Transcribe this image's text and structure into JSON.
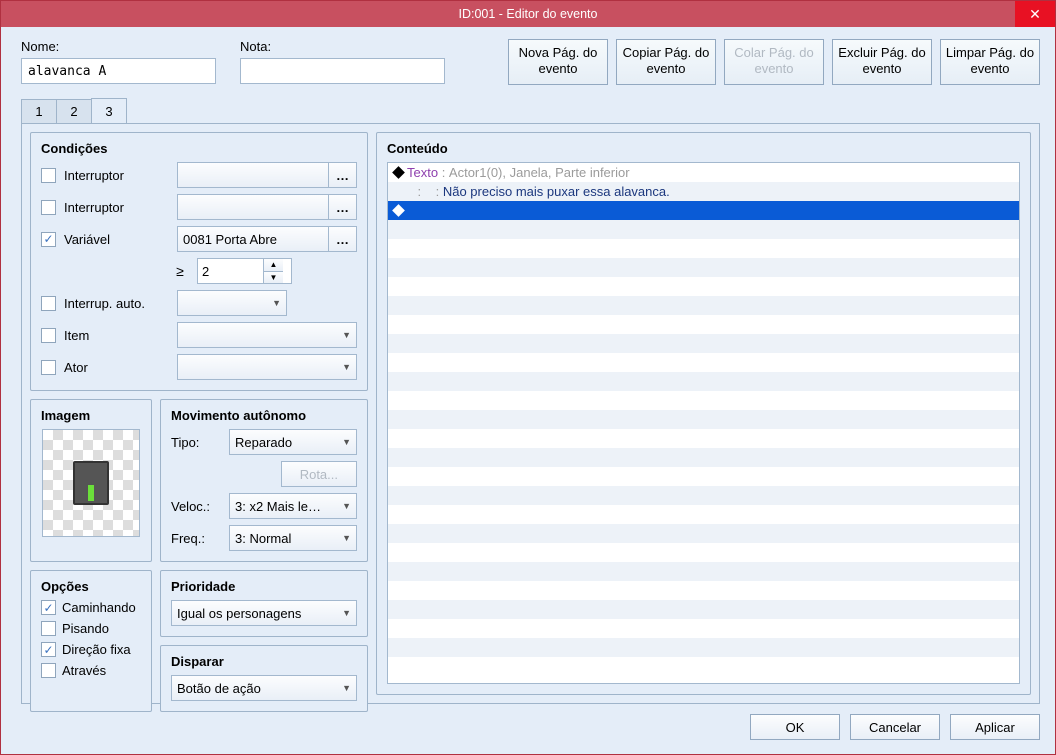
{
  "window": {
    "title": "ID:001 - Editor do evento"
  },
  "icons": {
    "close": "✕",
    "caret": "▼",
    "up": "▲",
    "down": "▼",
    "check": "✓"
  },
  "top": {
    "name_label": "Nome:",
    "name_value": "alavanca A",
    "note_label": "Nota:",
    "note_value": ""
  },
  "page_buttons": {
    "new": "Nova Pág. do evento",
    "copy": "Copiar Pág. do evento",
    "paste": "Colar Pág. do evento",
    "delete": "Excluir Pág. do evento",
    "clear": "Limpar Pág. do evento"
  },
  "tabs": [
    "1",
    "2",
    "3"
  ],
  "active_tab": 2,
  "conditions": {
    "title": "Condições",
    "switch1": {
      "checked": false,
      "label": "Interruptor",
      "value": ""
    },
    "switch2": {
      "checked": false,
      "label": "Interruptor",
      "value": ""
    },
    "variable": {
      "checked": true,
      "label": "Variável",
      "value": "0081 Porta Abre",
      "op": "≥",
      "num": "2"
    },
    "selfswitch": {
      "checked": false,
      "label": "Interrup. auto.",
      "value": ""
    },
    "item": {
      "checked": false,
      "label": "Item",
      "value": ""
    },
    "actor": {
      "checked": false,
      "label": "Ator",
      "value": ""
    }
  },
  "image": {
    "title": "Imagem"
  },
  "movement": {
    "title": "Movimento autônomo",
    "type_label": "Tipo:",
    "type_value": "Reparado",
    "route_btn": "Rota...",
    "speed_label": "Veloc.:",
    "speed_value": "3: x2 Mais le…",
    "freq_label": "Freq.:",
    "freq_value": "3: Normal"
  },
  "options": {
    "title": "Opções",
    "walk": {
      "checked": true,
      "label": "Caminhando"
    },
    "step": {
      "checked": false,
      "label": "Pisando"
    },
    "dirfix": {
      "checked": true,
      "label": "Direção fixa"
    },
    "through": {
      "checked": false,
      "label": "Através"
    }
  },
  "priority": {
    "title": "Prioridade",
    "value": "Igual os personagens"
  },
  "trigger": {
    "title": "Disparar",
    "value": "Botão de ação"
  },
  "content": {
    "title": "Conteúdo",
    "line0": {
      "key": "Texto",
      "rest": "Actor1(0), Janela, Parte inferior"
    },
    "line1": "Não preciso mais puxar essa alavanca."
  },
  "footer": {
    "ok": "OK",
    "cancel": "Cancelar",
    "apply": "Aplicar"
  }
}
